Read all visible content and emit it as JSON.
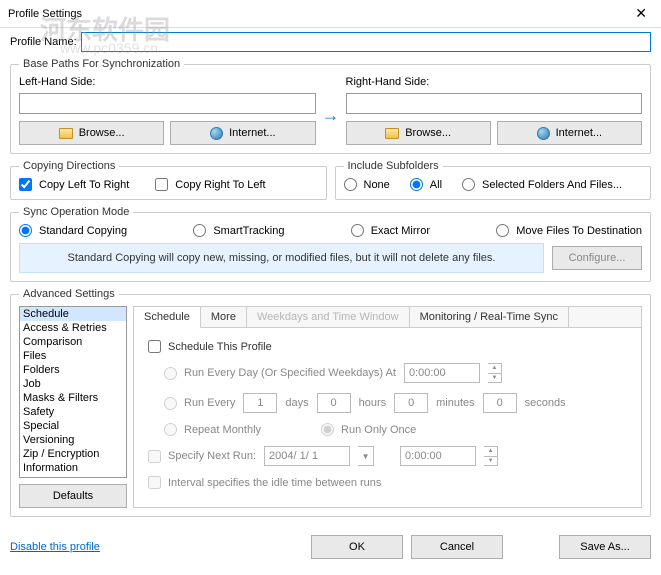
{
  "title": "Profile Settings",
  "watermark": {
    "line1": "河东软件园",
    "line2": "www.pc0359.cn"
  },
  "profile_name_label": "Profile Name:",
  "profile_name_value": "",
  "base_paths": {
    "legend": "Base Paths For Synchronization",
    "left_label": "Left-Hand Side:",
    "right_label": "Right-Hand Side:",
    "left_value": "",
    "right_value": "",
    "browse": "Browse...",
    "internet": "Internet..."
  },
  "copying": {
    "legend": "Copying Directions",
    "left_to_right": "Copy Left To Right",
    "right_to_left": "Copy Right To Left",
    "ltr_checked": true,
    "rtl_checked": false
  },
  "subfolders": {
    "legend": "Include Subfolders",
    "none": "None",
    "all": "All",
    "selected": "Selected Folders And Files...",
    "value": "all"
  },
  "sync_mode": {
    "legend": "Sync Operation Mode",
    "standard": "Standard Copying",
    "smart": "SmartTracking",
    "exact": "Exact Mirror",
    "move": "Move Files To Destination",
    "value": "standard",
    "hint": "Standard Copying will copy new, missing, or modified files, but it will not delete any files.",
    "configure": "Configure..."
  },
  "advanced": {
    "legend": "Advanced Settings",
    "items": [
      "Schedule",
      "Access & Retries",
      "Comparison",
      "Files",
      "Folders",
      "Job",
      "Masks & Filters",
      "Safety",
      "Special",
      "Versioning",
      "Zip / Encryption",
      "Information"
    ],
    "selected_index": 0,
    "defaults": "Defaults"
  },
  "tabs": {
    "schedule": "Schedule",
    "more": "More",
    "weekdays": "Weekdays and Time Window",
    "monitoring": "Monitoring / Real-Time Sync"
  },
  "schedule": {
    "enable": "Schedule This Profile",
    "run_every_day": "Run Every Day (Or Specified Weekdays) At",
    "time1": "0:00:00",
    "run_every": "Run Every",
    "days_val": "1",
    "days_lbl": "days",
    "hours_val": "0",
    "hours_lbl": "hours",
    "minutes_val": "0",
    "minutes_lbl": "minutes",
    "seconds_val": "0",
    "seconds_lbl": "seconds",
    "repeat_monthly": "Repeat Monthly",
    "run_once": "Run Only Once",
    "specify_next": "Specify Next Run:",
    "date": "2004/ 1/ 1",
    "time2": "0:00:00",
    "idle": "Interval specifies the idle time between runs"
  },
  "footer": {
    "disable": "Disable this profile",
    "ok": "OK",
    "cancel": "Cancel",
    "save_as": "Save As..."
  }
}
